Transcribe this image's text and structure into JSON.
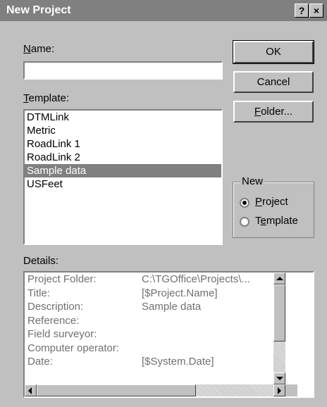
{
  "window": {
    "title": "New Project",
    "help_label": "?",
    "close_label": "×"
  },
  "name_field": {
    "label_mnemonic": "N",
    "label_rest": "ame:",
    "value": ""
  },
  "template": {
    "label_mnemonic": "T",
    "label_rest": "emplate:",
    "items": [
      "DTMLink",
      "Metric",
      "RoadLink 1",
      "RoadLink 2",
      "Sample data",
      "USFeet"
    ],
    "selected": "Sample data"
  },
  "buttons": {
    "ok": "OK",
    "cancel": "Cancel",
    "folder_mnemonic": "F",
    "folder_rest": "older..."
  },
  "new_group": {
    "label": "New",
    "project_mnemonic": "P",
    "project_rest": "roject",
    "template_pre": "T",
    "template_mnemonic": "e",
    "template_rest": "mplate",
    "selected": "Project"
  },
  "details": {
    "label": "Details:",
    "rows": [
      {
        "key": "Project Folder:",
        "value": "C:\\TGOffice\\Projects\\..."
      },
      {
        "key": "Title:",
        "value": "[$Project.Name]"
      },
      {
        "key": "Description:",
        "value": "Sample data"
      },
      {
        "key": "Reference:",
        "value": ""
      },
      {
        "key": "Field surveyor:",
        "value": ""
      },
      {
        "key": "Computer operator:",
        "value": ""
      },
      {
        "key": "Date:",
        "value": "[$System.Date]"
      }
    ]
  },
  "colors": {
    "face": "#c0c0c0",
    "selection": "#808080",
    "titlebar": "#808080",
    "details_text": "#707070"
  }
}
